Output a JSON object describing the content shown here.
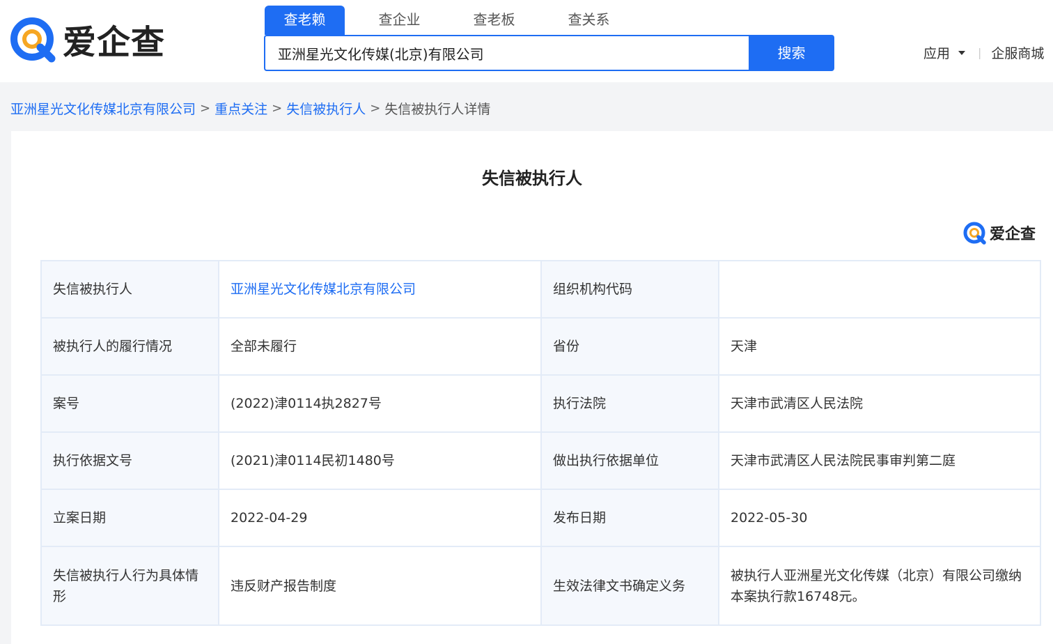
{
  "header": {
    "logo_text": "爱企查",
    "tabs": [
      "查老赖",
      "查企业",
      "查老板",
      "查关系"
    ],
    "search": {
      "value": "亚洲星光文化传媒(北京)有限公司",
      "button_label": "搜索"
    },
    "nav": {
      "apps_label": "应用",
      "divider": "|",
      "mall_label": "企服商城"
    }
  },
  "breadcrumb": {
    "items": [
      "亚洲星光文化传媒北京有限公司",
      "重点关注",
      "失信被执行人"
    ],
    "current": "失信被执行人详情",
    "separator": ">"
  },
  "card": {
    "title": "失信被执行人",
    "watermark_text": "爱企查"
  },
  "details": {
    "rows": [
      {
        "l1": "失信被执行人",
        "v1": "亚洲星光文化传媒北京有限公司",
        "l2": "组织机构代码",
        "v2": ""
      },
      {
        "l1": "被执行人的履行情况",
        "v1": "全部未履行",
        "l2": "省份",
        "v2": "天津"
      },
      {
        "l1": "案号",
        "v1": "(2022)津0114执2827号",
        "l2": "执行法院",
        "v2": "天津市武清区人民法院"
      },
      {
        "l1": "执行依据文号",
        "v1": "(2021)津0114民初1480号",
        "l2": "做出执行依据单位",
        "v2": "天津市武清区人民法院民事审判第二庭"
      },
      {
        "l1": "立案日期",
        "v1": "2022-04-29",
        "l2": "发布日期",
        "v2": "2022-05-30"
      },
      {
        "l1": "失信被执行人行为具体情形",
        "v1": "违反财产报告制度",
        "l2": "生效法律文书确定义务",
        "v2": "被执行人亚洲星光文化传媒（北京）有限公司缴纳本案执行款16748元。"
      }
    ]
  },
  "colors": {
    "brand_blue": "#1e6df3",
    "logo_orange": "#f6a623",
    "label_bg": "#f5f8fd",
    "border": "#e3ebf7",
    "page_bg": "#f3f4f6"
  }
}
